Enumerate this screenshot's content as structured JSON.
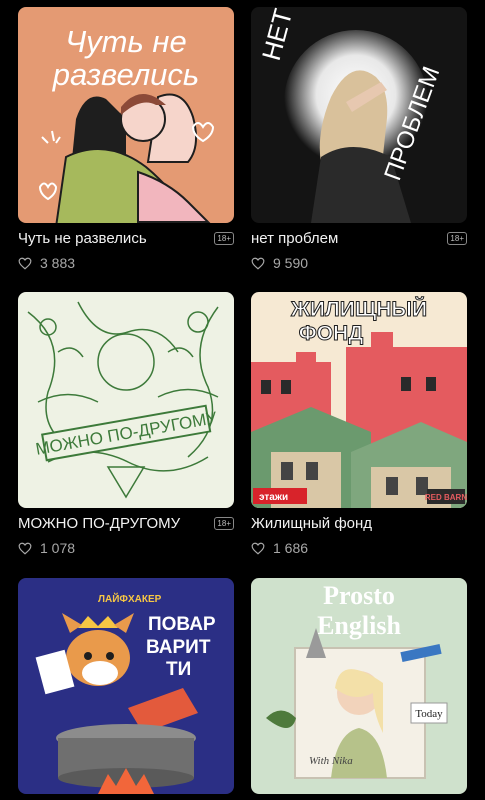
{
  "podcasts": [
    {
      "title": "Чуть не развелись",
      "age": "18+",
      "likes": "3 883",
      "cover": {
        "line1": "Чуть не",
        "line2": "развелись",
        "bg": "#e49a73"
      }
    },
    {
      "title": "нет проблем",
      "age": "18+",
      "likes": "9 590",
      "cover": {
        "word1": "НЕТ",
        "word2": "ПРОБЛЕМ",
        "bg": "#141414"
      }
    },
    {
      "title": "МОЖНО ПО-ДРУГОМУ",
      "age": "18+",
      "likes": "1 078",
      "cover": {
        "banner": "МОЖНО ПО-ДРУГОМУ",
        "bg": "#eef2e4"
      }
    },
    {
      "title": "Жилищный фонд",
      "age": "",
      "likes": "1 686",
      "cover": {
        "line1": "ЖИЛИЩНЫЙ",
        "line2": "ФОНД",
        "brand_left": "этажи",
        "brand_right": "RED BARN",
        "bg": "#f6e9d3"
      }
    },
    {
      "title": "",
      "age": "",
      "likes": "",
      "cover": {
        "brand": "ЛАЙФХАКЕР",
        "line1": "ПОВАР",
        "line2": "ВАРИТ",
        "line3": "ТИ",
        "bg": "#2b2f85"
      }
    },
    {
      "title": "",
      "age": "",
      "likes": "",
      "cover": {
        "line1": "Prosto",
        "line2": "English",
        "signature": "With Nika",
        "badge": "Today",
        "bg": "#cfe1cc"
      }
    }
  ],
  "colors": {
    "background": "#000000",
    "text": "#f2f2f2",
    "muted": "#a8a8a8"
  },
  "icons": {
    "like": "heart-icon",
    "age": "age-rating-badge"
  }
}
